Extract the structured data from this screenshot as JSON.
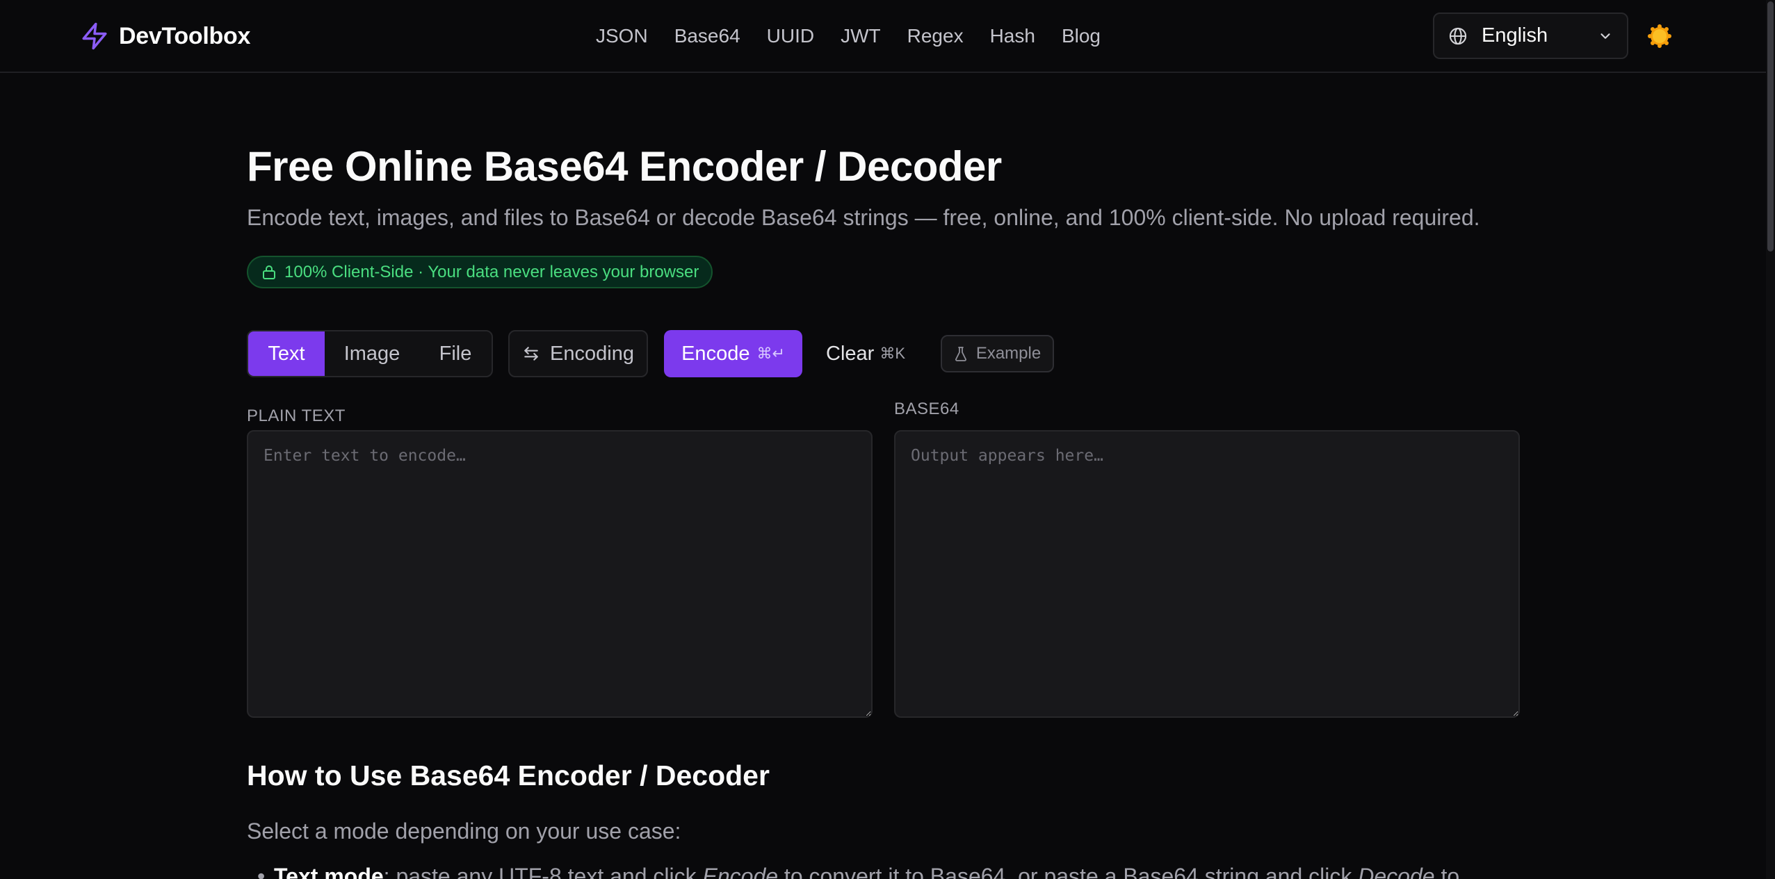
{
  "colors": {
    "background": "#09090b",
    "accent": "#7c3aed",
    "success_text": "#4ade80",
    "muted_text": "#a1a1aa"
  },
  "header": {
    "brand": "DevToolbox",
    "brand_icon": "lightning-bolt-icon",
    "nav": [
      "JSON",
      "Base64",
      "UUID",
      "JWT",
      "Regex",
      "Hash",
      "Blog"
    ],
    "language": {
      "icon": "globe-icon",
      "selected": "English"
    },
    "theme_icon": "sun-icon"
  },
  "main": {
    "title": "Free Online Base64 Encoder / Decoder",
    "subtitle": "Encode text, images, and files to Base64 or decode Base64 strings — free, online, and 100% client-side. No upload required.",
    "badge": "100% Client-Side · Your data never leaves your browser",
    "toolbar": {
      "modes": [
        "Text",
        "Image",
        "File"
      ],
      "active_mode": "Text",
      "encoding_label": "Encoding",
      "encode_label": "Encode",
      "encode_shortcut": "⌘↵",
      "clear_label": "Clear",
      "clear_shortcut": "⌘K",
      "example_label": "Example"
    },
    "input": {
      "label": "PLAIN TEXT",
      "placeholder": "Enter text to encode…",
      "value": ""
    },
    "output": {
      "label": "BASE64",
      "placeholder": "Output appears here…",
      "value": ""
    },
    "howto": {
      "title": "How to Use Base64 Encoder / Decoder",
      "intro": "Select a mode depending on your use case:",
      "item_bold": "Text mode",
      "item_text_1": ": paste any UTF-8 text and click ",
      "item_em_1": "Encode",
      "item_text_2": " to convert it to Base64, or paste a Base64 string and click ",
      "item_em_2": "Decode",
      "item_text_3": " to"
    }
  }
}
